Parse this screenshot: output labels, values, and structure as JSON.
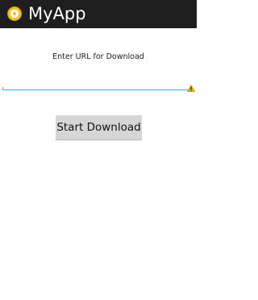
{
  "app_bar": {
    "title": "MyApp",
    "icon": "app-logo-icon"
  },
  "form": {
    "url_label": "Enter URL for Download",
    "url_value": "",
    "url_placeholder": "",
    "warning_icon": "warning-icon",
    "start_button_label": "Start Download"
  },
  "colors": {
    "app_bar_bg": "#1e1e1e",
    "input_underline": "#2fb3d9",
    "button_bg": "#d6d6d6",
    "warning": "#e0b400",
    "app_icon": "#f2c319"
  }
}
